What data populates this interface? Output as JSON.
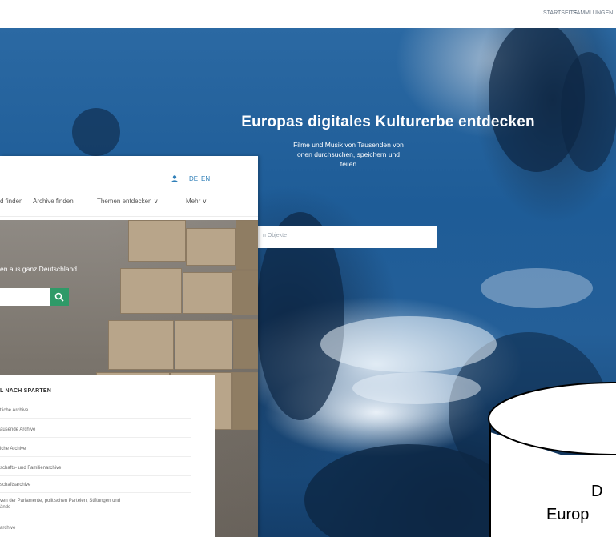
{
  "back_window": {
    "topbar_links": [
      "STARTSEITE",
      "SAMMLUNGEN"
    ],
    "hero_title": "Europas digitales Kulturerbe entdecken",
    "hero_subtitle_lines": [
      "Filme und Musik von Tausenden von",
      "onen durchsuchen, speichern und",
      "teilen"
    ],
    "search_placeholder": "n Objekte"
  },
  "front_window": {
    "language": {
      "de": "DE",
      "en": "EN"
    },
    "nav_items": [
      "d finden",
      "Archive finden",
      "Themen entdecken ∨",
      "Mehr ∨"
    ],
    "tagline": "en aus ganz Deutschland",
    "sparten": {
      "title": "L NACH SPARTEN",
      "items": [
        "tliche Archive",
        "ausende Archive",
        "iche Archive",
        "schafts- und Familienarchive",
        "schaftsarchive",
        "ven der Parlamente, politischen Parteien, Stiftungen und\nände",
        "archive"
      ]
    }
  },
  "overlay_shape": {
    "text_line_1": "D",
    "text_line_2": "Europ"
  },
  "colors": {
    "hero_blue": "#1e5c97",
    "search_green": "#2f9a68",
    "link_blue": "#2f7fb8"
  }
}
